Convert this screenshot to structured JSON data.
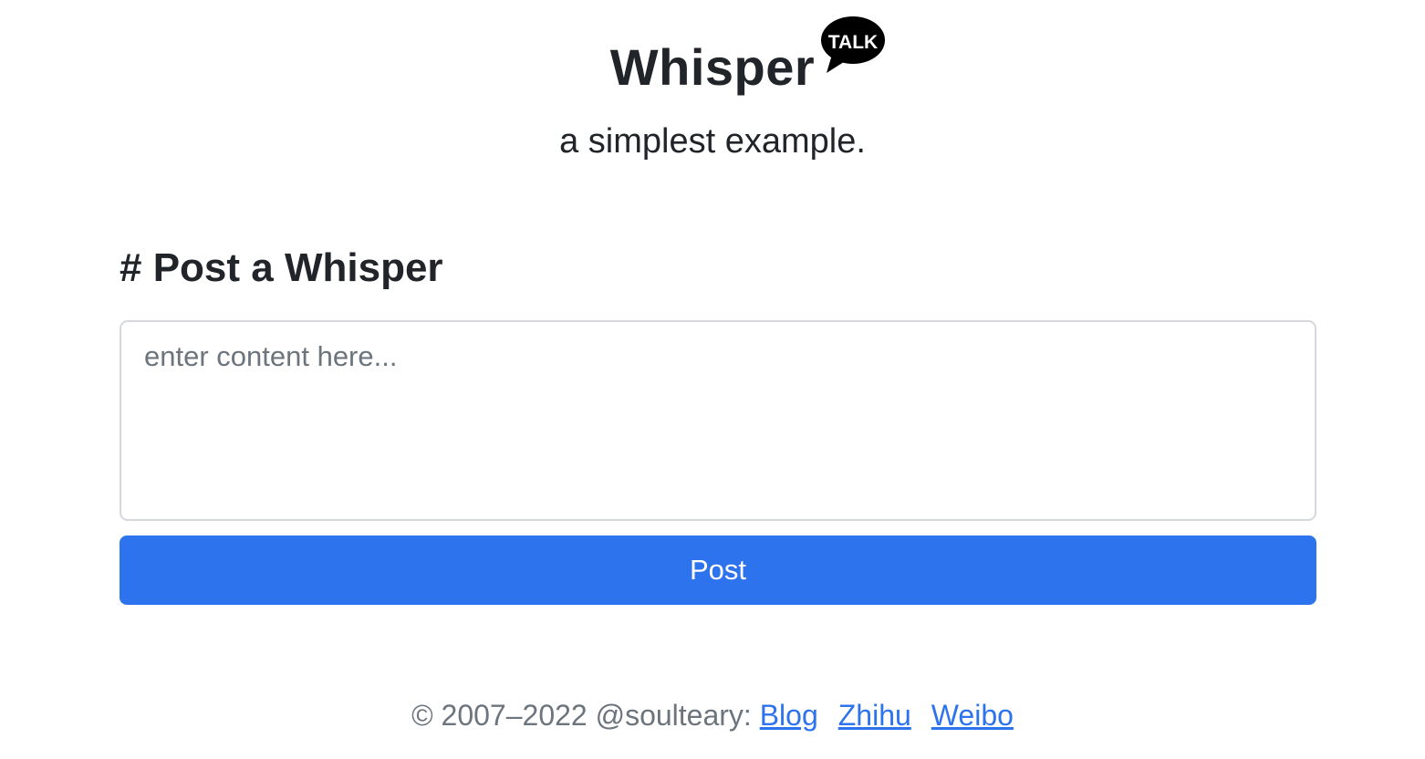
{
  "header": {
    "title": "Whisper",
    "badge": "TALK",
    "tagline": "a simplest example."
  },
  "form": {
    "heading": "# Post a Whisper",
    "content_placeholder": "enter content here...",
    "content_value": "",
    "submit_label": "Post"
  },
  "footer": {
    "copyright": "© 2007–2022 @soulteary:",
    "links": [
      {
        "label": "Blog"
      },
      {
        "label": "Zhihu"
      },
      {
        "label": "Weibo"
      }
    ]
  },
  "colors": {
    "accent": "#2e73ee",
    "text": "#212529",
    "muted": "#6c757d",
    "border": "#d5d8dc"
  },
  "icons": {
    "logo": "talk-bubble-icon"
  }
}
